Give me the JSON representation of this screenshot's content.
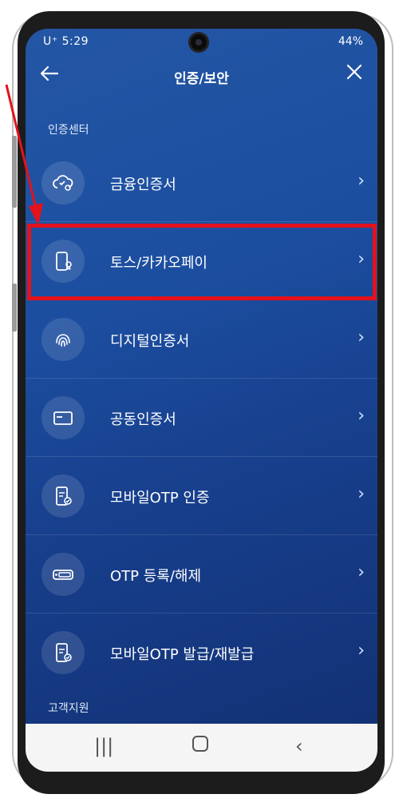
{
  "status_bar": {
    "left": "U⁺ 5:29 ",
    "right": "44%"
  },
  "header": {
    "title": "인증/보안",
    "back_icon": "arrow-left-icon",
    "close_icon": "close-icon"
  },
  "sections": {
    "auth_center": "인증센터",
    "customer_support": "고객지원"
  },
  "items": [
    {
      "label": "금융인증서",
      "icon": "cloud-cert-icon"
    },
    {
      "label": "토스/카카오페이",
      "icon": "phone-cert-icon"
    },
    {
      "label": "디지털인증서",
      "icon": "fingerprint-icon"
    },
    {
      "label": "공동인증서",
      "icon": "card-icon"
    },
    {
      "label": "모바일OTP 인증",
      "icon": "mobile-otp-icon"
    },
    {
      "label": "OTP 등록/해제",
      "icon": "otp-token-icon"
    },
    {
      "label": "모바일OTP 발급/재발급",
      "icon": "mobile-otp-issue-icon"
    }
  ],
  "highlight_color": "#e3121c",
  "accent_color": "#1c4ea0"
}
